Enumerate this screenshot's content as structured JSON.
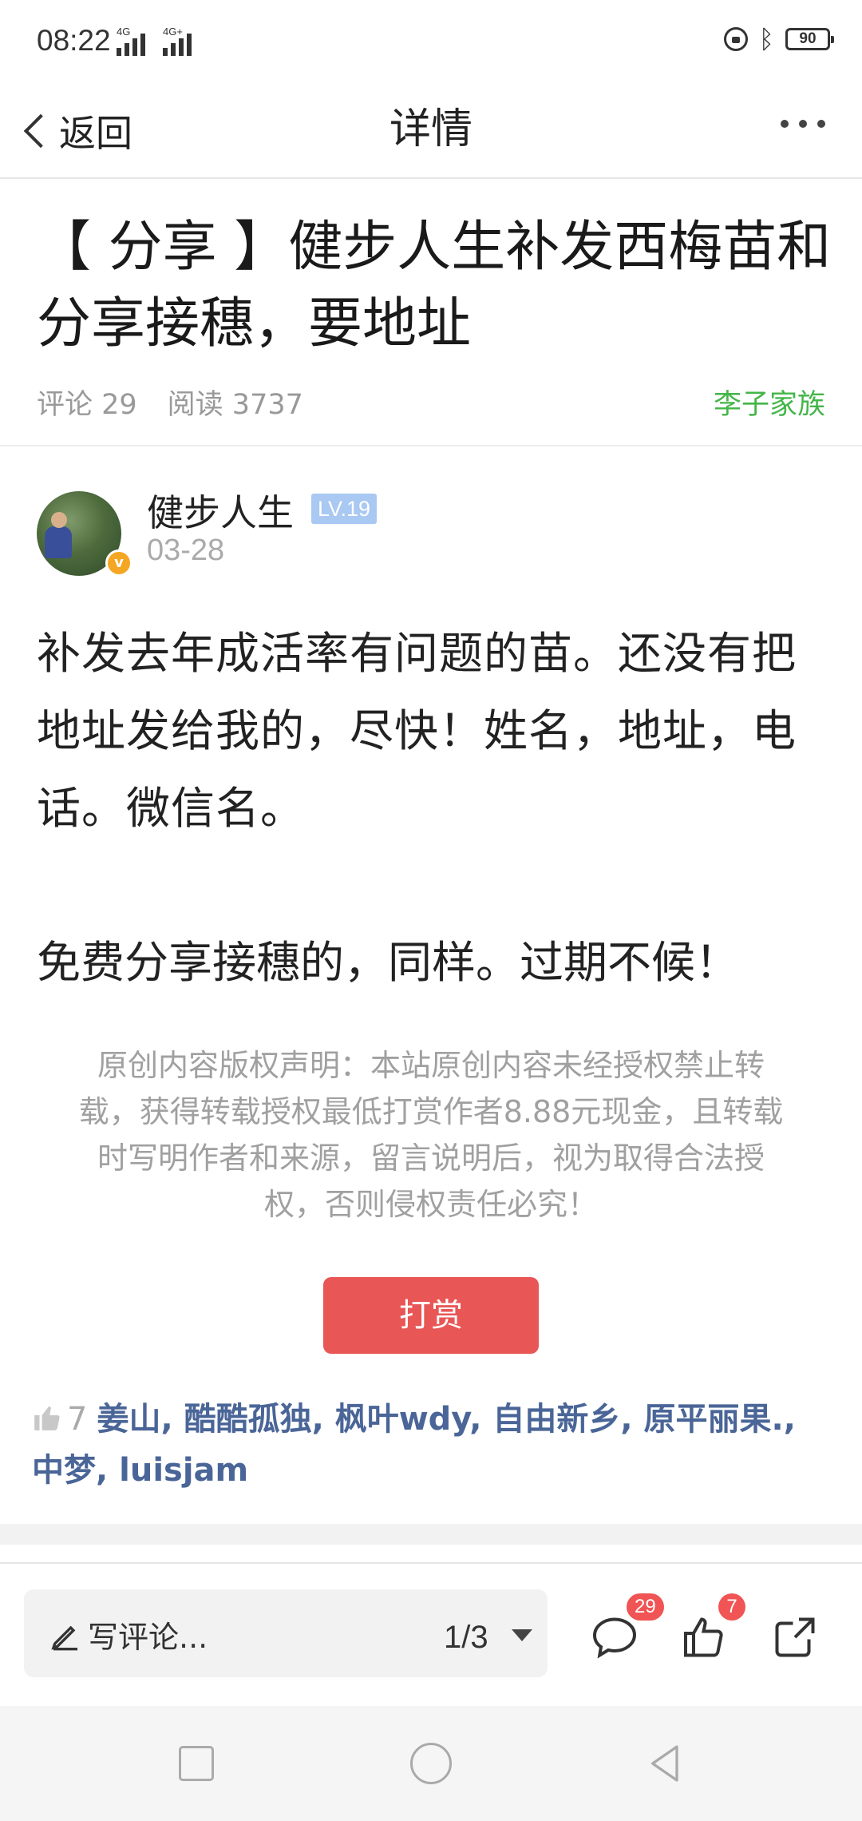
{
  "status_bar": {
    "time": "08:22",
    "signal1_label": "4G",
    "signal2_label": "4G+",
    "battery": "90"
  },
  "nav": {
    "back_label": "返回",
    "title": "详情"
  },
  "article": {
    "title": "【 分享 】健步人生补发西梅苗和分享接穗，要地址",
    "comments_label": "评论 29",
    "reads_label": "阅读 3737",
    "group": "李子家族"
  },
  "author": {
    "name": "健步人生",
    "level": "LV.19",
    "date": "03-28"
  },
  "content": {
    "paragraph1": "补发去年成活率有问题的苗。还没有把地址发给我的，尽快！姓名，地址，电话。微信名。",
    "paragraph2": "免费分享接穗的，同样。过期不候！",
    "copyright": "原创内容版权声明：本站原创内容未经授权禁止转载，获得转载授权最低打赏作者8.88元现金，且转载时写明作者和来源，留言说明后，视为取得合法授权，否则侵权责任必究！",
    "reward_button": "打赏"
  },
  "likes": {
    "count": "7",
    "users": [
      "姜山",
      "酷酷孤独",
      "枫叶wdy",
      "自由新乡",
      "原平丽果.",
      "中梦",
      "luisjam"
    ]
  },
  "bottom_bar": {
    "comment_placeholder": "写评论...",
    "page_indicator": "1/3",
    "comments_badge": "29",
    "likes_badge": "7"
  },
  "icons": {
    "pen": "pen-icon",
    "comments": "comment-bubble-icon",
    "like": "thumbs-up-icon",
    "share": "share-icon"
  },
  "colors": {
    "group_green": "#44b549",
    "reward_red": "#e85656",
    "badge_red": "#f05454",
    "liker_blue": "#4a6597",
    "level_blue": "#a9c8f2"
  }
}
